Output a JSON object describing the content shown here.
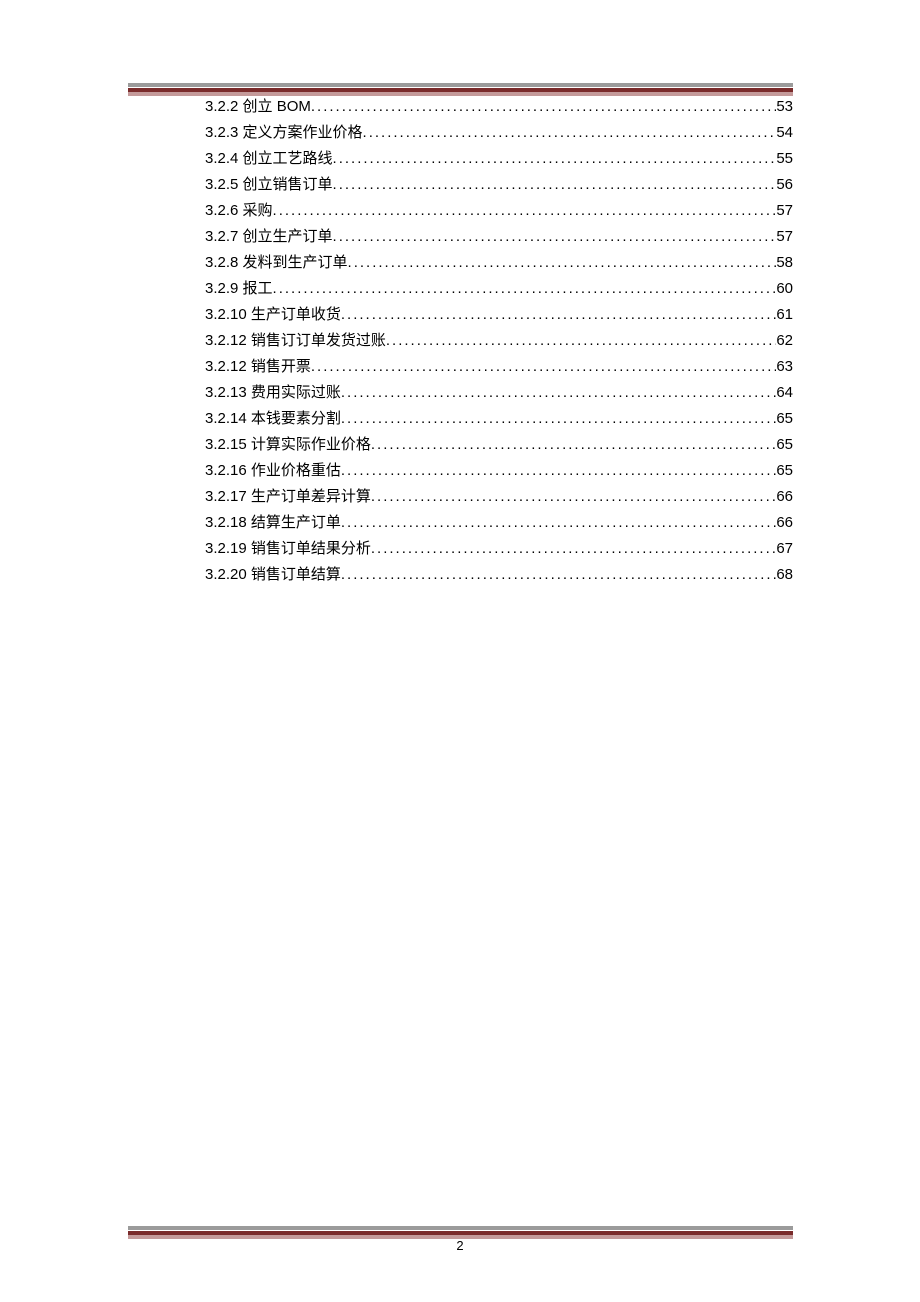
{
  "toc": {
    "entries": [
      {
        "label": "3.2.2 创立 BOM ",
        "page": "53"
      },
      {
        "label": "3.2.3 定义方案作业价格",
        "page": "54"
      },
      {
        "label": "3.2.4 创立工艺路线",
        "page": "55"
      },
      {
        "label": "3.2.5 创立销售订单",
        "page": "56"
      },
      {
        "label": "3.2.6 采购",
        "page": "57"
      },
      {
        "label": "3.2.7 创立生产订单",
        "page": "57"
      },
      {
        "label": "3.2.8 发料到生产订单",
        "page": "58"
      },
      {
        "label": "3.2.9 报工",
        "page": "60"
      },
      {
        "label": "3.2.10 生产订单收货",
        "page": "61"
      },
      {
        "label": "3.2.12 销售订订单发货过账",
        "page": "62"
      },
      {
        "label": "3.2.12 销售开票",
        "page": "63"
      },
      {
        "label": "3.2.13 费用实际过账",
        "page": "64"
      },
      {
        "label": "3.2.14 本钱要素分割",
        "page": "65"
      },
      {
        "label": "3.2.15 计算实际作业价格",
        "page": "65"
      },
      {
        "label": "3.2.16 作业价格重估",
        "page": "65"
      },
      {
        "label": "3.2.17 生产订单差异计算",
        "page": "66"
      },
      {
        "label": "3.2.18 结算生产订单",
        "page": "66"
      },
      {
        "label": "3.2.19 销售订单结果分析",
        "page": "67"
      },
      {
        "label": "3.2.20 销售订单结算",
        "page": "68"
      }
    ]
  },
  "page_number": "2"
}
